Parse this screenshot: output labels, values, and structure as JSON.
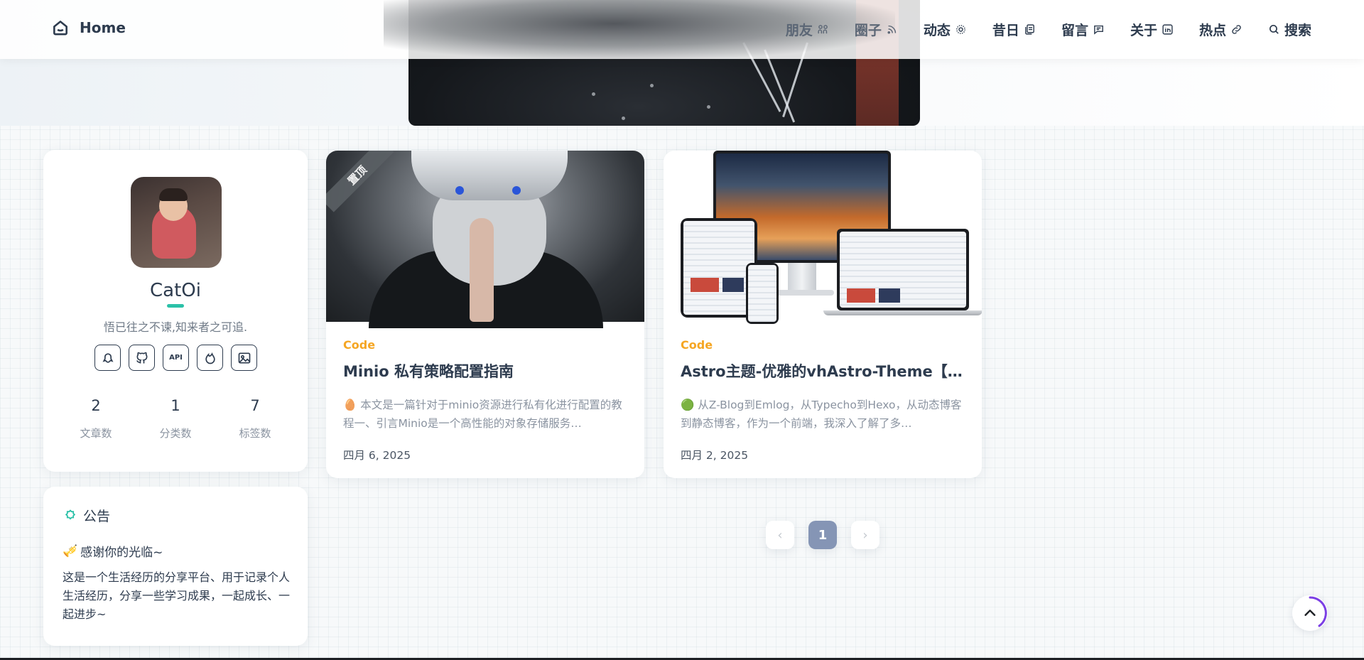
{
  "brand": {
    "label": "Home",
    "icon": "home-icon"
  },
  "nav": [
    {
      "label": "朋友",
      "icon": "friends-icon"
    },
    {
      "label": "圈子",
      "icon": "rss-icon"
    },
    {
      "label": "动态",
      "icon": "activity-icon"
    },
    {
      "label": "昔日",
      "icon": "archive-icon"
    },
    {
      "label": "留言",
      "icon": "message-icon"
    },
    {
      "label": "关于",
      "icon": "about-icon"
    },
    {
      "label": "热点",
      "icon": "link-icon"
    },
    {
      "label": "搜索",
      "icon": "search-icon"
    }
  ],
  "profile": {
    "name": "CatOi",
    "bio": "悟已往之不谏,知来者之可追.",
    "socials": [
      {
        "icon": "qq-icon"
      },
      {
        "icon": "github-icon"
      },
      {
        "icon": "api-icon",
        "text": "API"
      },
      {
        "icon": "fire-icon"
      },
      {
        "icon": "image-icon"
      }
    ],
    "stats": [
      {
        "value": "2",
        "label": "文章数"
      },
      {
        "value": "1",
        "label": "分类数"
      },
      {
        "value": "7",
        "label": "标签数"
      }
    ]
  },
  "notice": {
    "title": "公告",
    "greeting": "感谢你的光临~",
    "greeting_emoji": "🎺",
    "body": "这是一个生活经历的分享平台、用于记录个人生活经历，分享一些学习成果，一起成长、一起进步~"
  },
  "posts": [
    {
      "pin_label": "置顶",
      "category": "Code",
      "title": "Minio 私有策略配置指南",
      "excerpt_emoji": "🥚",
      "excerpt": "本文是一篇针对于minio资源进行私有化进行配置的教程一、引言Minio是一个高性能的对象存储服务…",
      "date": "四月 6, 2025"
    },
    {
      "category": "Code",
      "title": "Astro主题-优雅的vhAstro-Theme【使…",
      "excerpt_emoji": "🟢",
      "excerpt": "从Z-Blog到Emlog，从Typecho到Hexo，从动态博客到静态博客，作为一个前端，我深入了解了多…",
      "date": "四月 2, 2025"
    }
  ],
  "pagination": {
    "prev": "‹",
    "current": "1",
    "next": "›"
  },
  "colors": {
    "accent": "#2bc1a8",
    "category": "#f5a623",
    "pager_active": "#8595b5",
    "text": "#2d3b4e"
  }
}
